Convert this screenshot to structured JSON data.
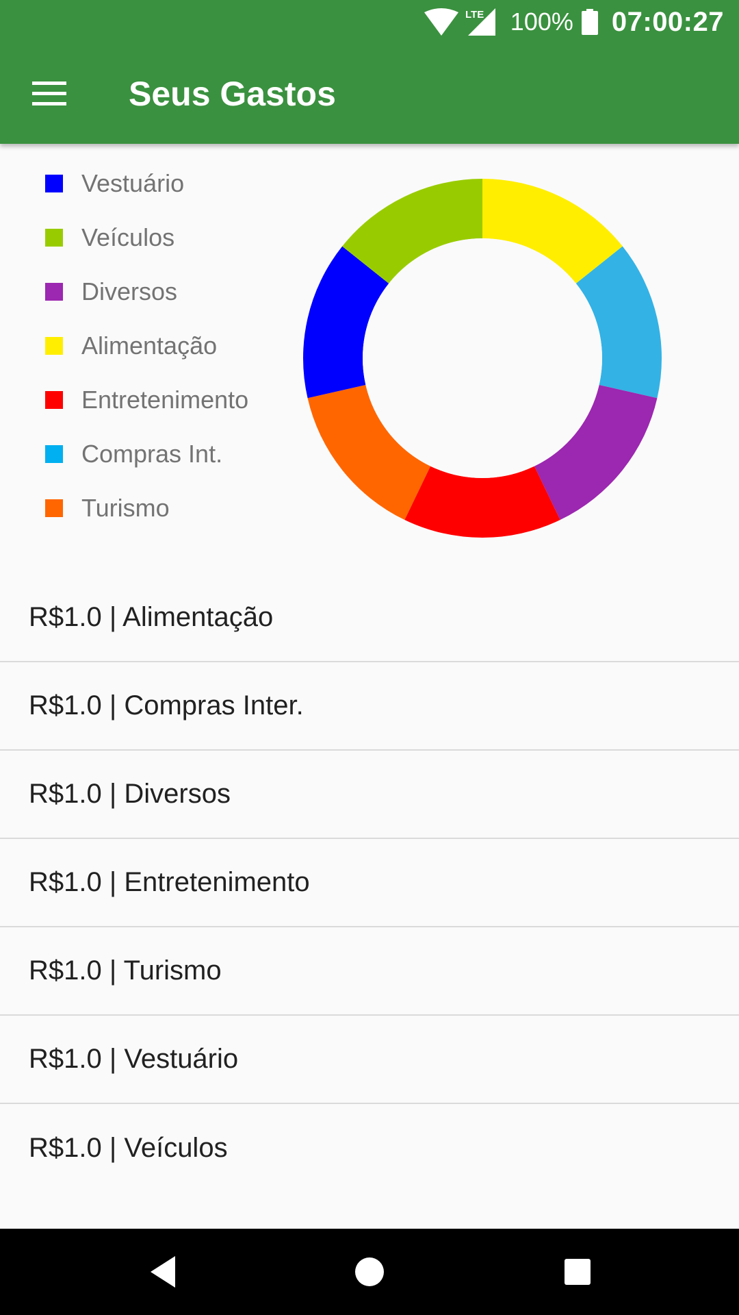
{
  "status_bar": {
    "battery": "100%",
    "time": "07:00:27",
    "icons": [
      "wifi-icon",
      "lte-signal-icon",
      "battery-icon"
    ]
  },
  "toolbar": {
    "title": "Seus Gastos",
    "menu_icon": "hamburger-menu-icon"
  },
  "legend": [
    {
      "label": "Vestuário",
      "color": "#0000ff"
    },
    {
      "label": "Veículos",
      "color": "#99cc00"
    },
    {
      "label": "Diversos",
      "color": "#9c27b0"
    },
    {
      "label": "Alimentação",
      "color": "#ffee00"
    },
    {
      "label": "Entretenimento",
      "color": "#ff0000"
    },
    {
      "label": "Compras Int.",
      "color": "#00b0f0"
    },
    {
      "label": "Turismo",
      "color": "#ff6600"
    }
  ],
  "chart_data": {
    "type": "pie",
    "donut": true,
    "legend_position": "left",
    "start_angle": "top",
    "direction": "clockwise",
    "slices": [
      {
        "label": "Alimentação",
        "value": 1.0,
        "color": "#ffee00"
      },
      {
        "label": "Compras Int.",
        "value": 1.0,
        "color": "#33b2e5"
      },
      {
        "label": "Diversos",
        "value": 1.0,
        "color": "#9c27b0"
      },
      {
        "label": "Entretenimento",
        "value": 1.0,
        "color": "#ff0000"
      },
      {
        "label": "Turismo",
        "value": 1.0,
        "color": "#ff6600"
      },
      {
        "label": "Vestuário",
        "value": 1.0,
        "color": "#0000ff"
      },
      {
        "label": "Veículos",
        "value": 1.0,
        "color": "#99cc00"
      }
    ]
  },
  "expenses": [
    "R$1.0 | Alimentação",
    "R$1.0 | Compras Inter.",
    "R$1.0 | Diversos",
    "R$1.0 | Entretenimento",
    "R$1.0 | Turismo",
    "R$1.0 | Vestuário",
    "R$1.0 | Veículos"
  ],
  "nav_bar": {
    "back_icon": "back-icon",
    "home_icon": "home-icon",
    "recents_icon": "recents-icon"
  }
}
